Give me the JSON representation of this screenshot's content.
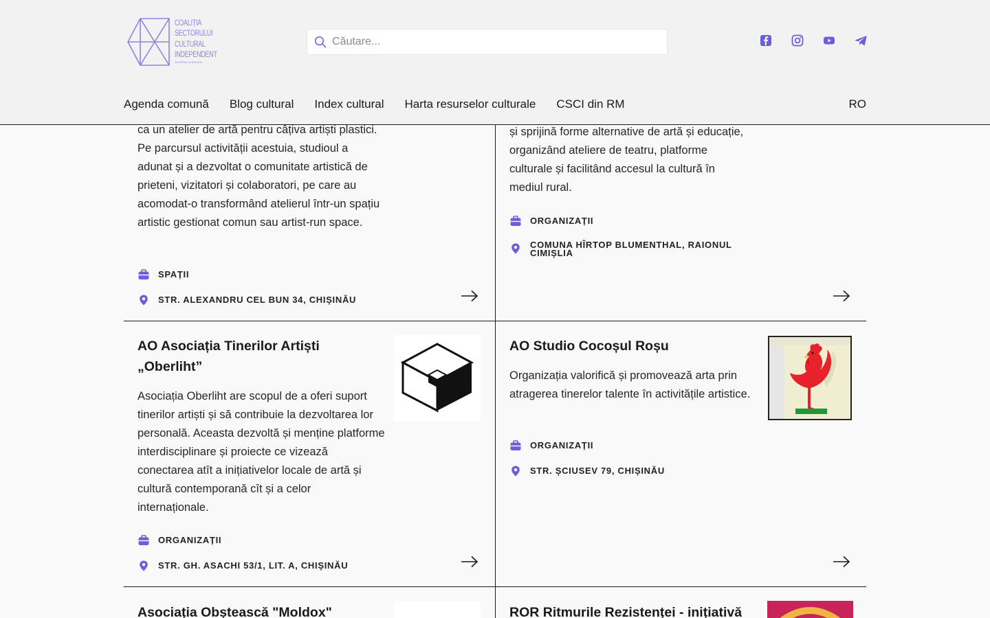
{
  "brand": {
    "logo_lines": [
      "COALIȚIA",
      "SECTORULUI",
      "CULTURAL",
      "INDEPENDENT"
    ],
    "logo_sub": "DIN REPUBLICA MOLDOVA",
    "accent": "#8c83e6"
  },
  "search": {
    "placeholder": "Căutare..."
  },
  "social": [
    "facebook-icon",
    "instagram-icon",
    "youtube-icon",
    "telegram-icon"
  ],
  "nav": {
    "items": [
      "Agenda comună",
      "Blog cultural",
      "Index cultural",
      "Harta resurselor culturale",
      "CSCI din RM"
    ],
    "lang": "RO"
  },
  "cards": [
    {
      "desc": "ca un atelier de artă pentru câțiva artiști plastici. Pe parcursul activității acestuia, studioul a adunat și a dezvoltat o comunitate artistică de prieteni, vizitatori și colaboratori, pe care au acomodat-o transformând atelierul într-un spațiu artistic gestionat comun sau artist-run space.",
      "category": "Spații",
      "address": "Str. Alexandru cel Bun 34, Chișinău"
    },
    {
      "desc": "și sprijină forme alternative de artă și educație, organizând ateliere de teatru, platforme culturale și facilitând accesul la cultură în mediul rural.",
      "category": "Organizații",
      "address": "Comuna Hîrtop Blumenthal, raionul Cimișlia"
    },
    {
      "title": "AO Asociația Tinerilor Artiști „Oberliht”",
      "desc": "Asociația Oberliht are scopul de a oferi suport tinerilor artiști și să contribuie la dezvoltarea lor personală. Aceasta dezvoltă și menține platforme interdisciplinare și proiecte ce vizează conectarea atît a inițiativelor locale de artă și cultură contemporană cît și a celor internaționale.",
      "category": "Organizații",
      "address": "Str. Gh. Asachi 53/1, lit. A, Chișinău"
    },
    {
      "title": "AO Studio Cocoșul Roșu",
      "desc": "Organizația valorifică și promovează arta prin atragerea tinerelor talente în activitățile artistice.",
      "category": "Organizații",
      "address": "Str. Șciusev 79, Chișinău"
    },
    {
      "title": "Asociația Obștească \"Moldox\""
    },
    {
      "title": "ROR Ritmurile Rezistenței - inițiativă"
    }
  ]
}
